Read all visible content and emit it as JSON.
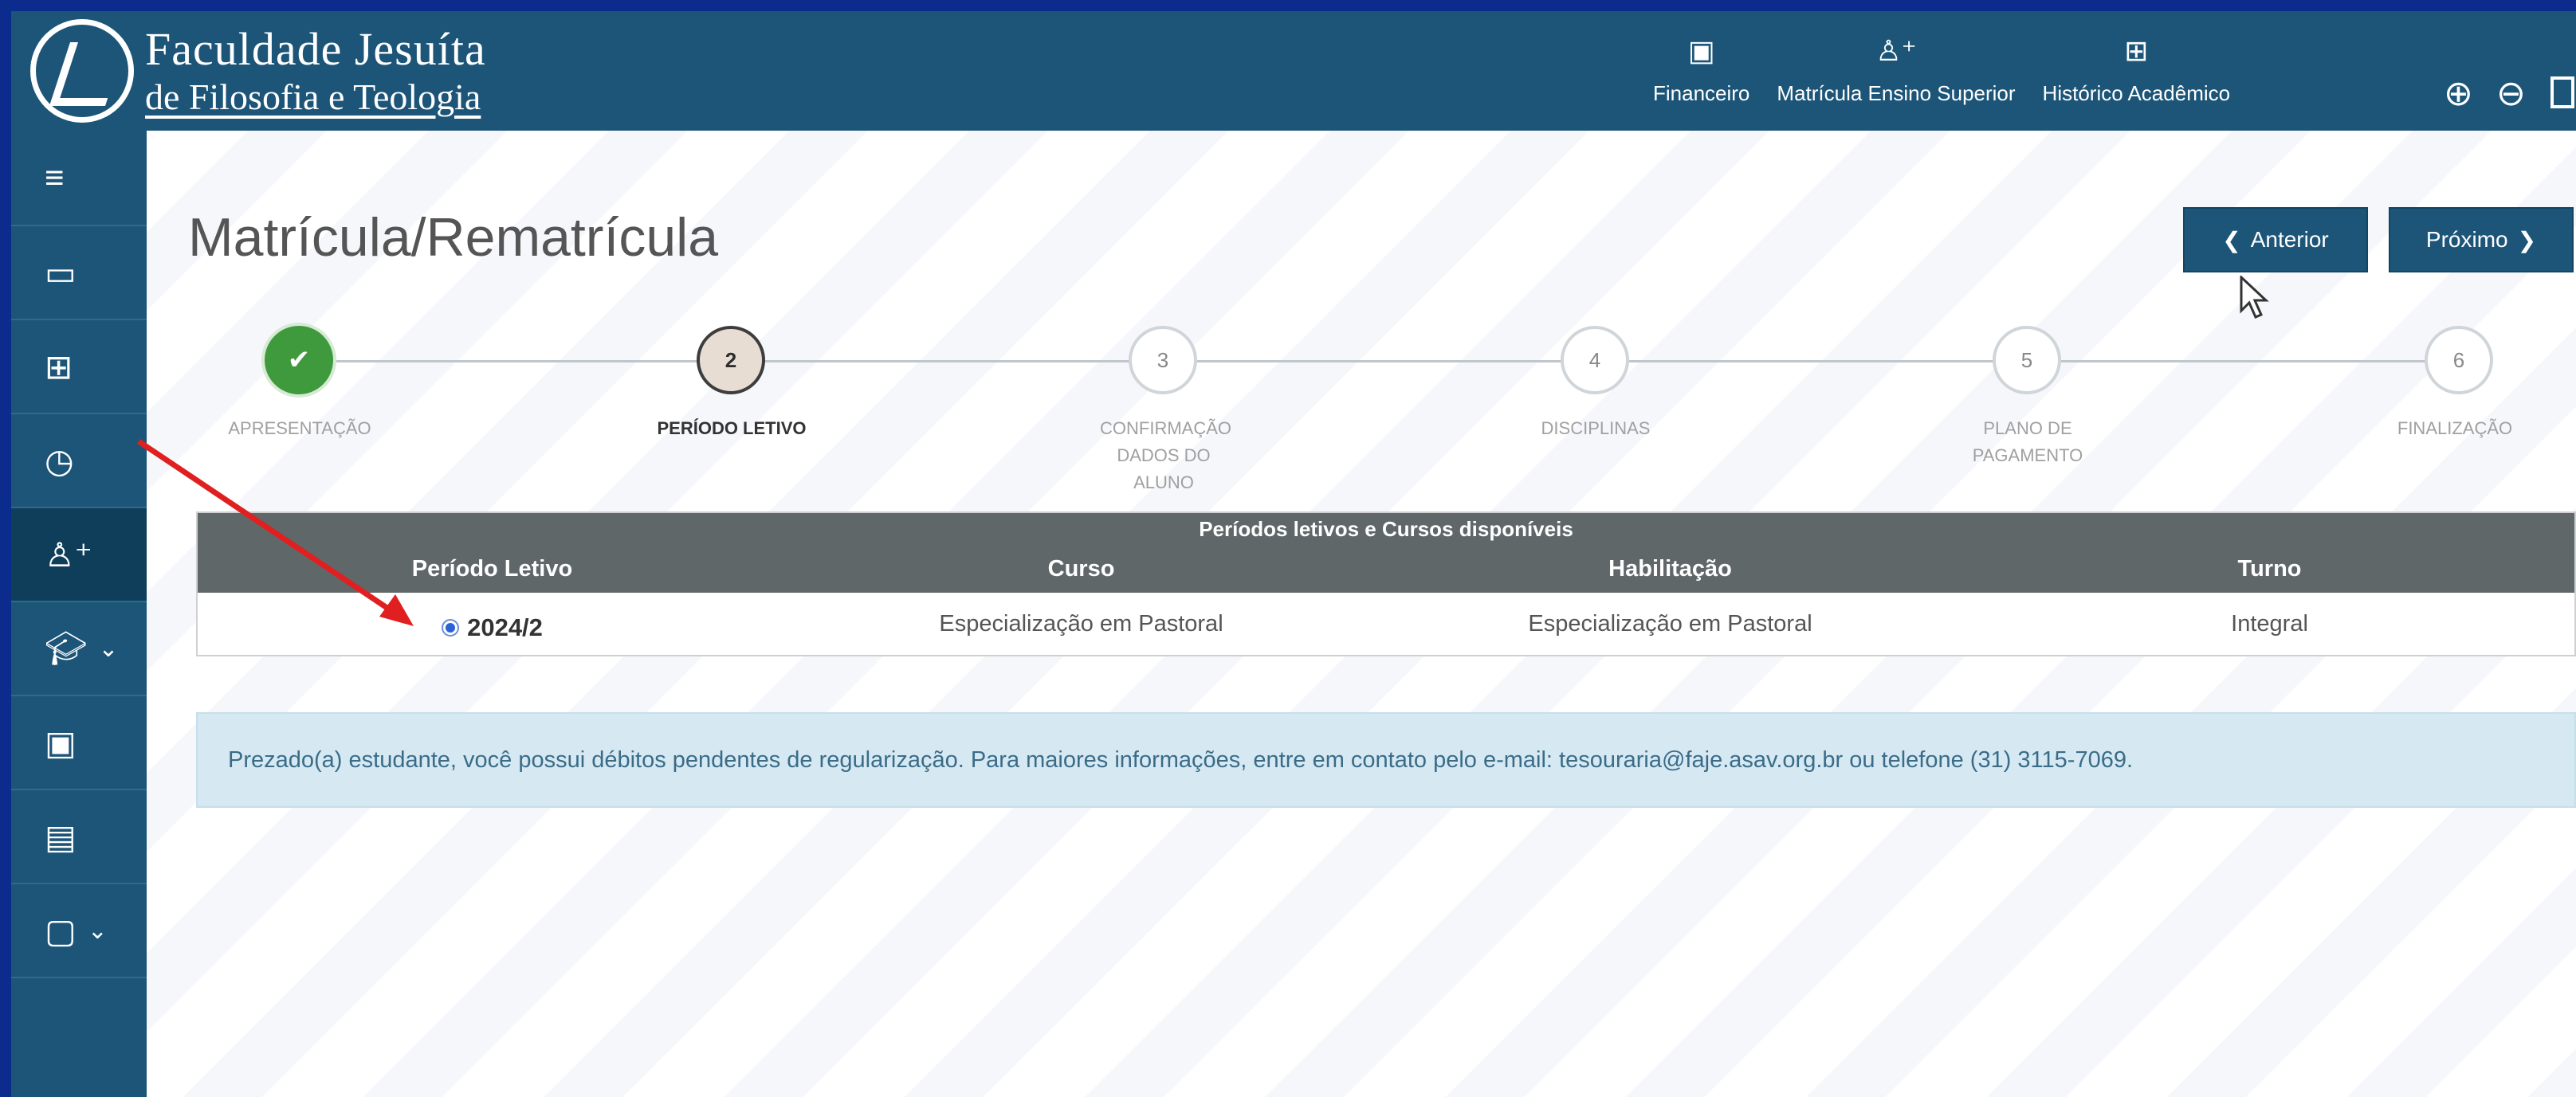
{
  "brand": {
    "line1": "Faculdade Jesuíta",
    "line2": "de Filosofia e Teologia"
  },
  "topnav": [
    {
      "label": "Financeiro",
      "icon": "dollar-doc-icon"
    },
    {
      "label": "Matrícula Ensino Superior",
      "icon": "add-user-icon"
    },
    {
      "label": "Histórico Acadêmico",
      "icon": "grid-icon"
    }
  ],
  "zoom": {
    "in_icon": "zoom-in-icon",
    "out_icon": "zoom-out-icon"
  },
  "sidebar": [
    {
      "icon": "menu-icon"
    },
    {
      "icon": "monitor-icon"
    },
    {
      "icon": "grid-icon"
    },
    {
      "icon": "clock-icon"
    },
    {
      "icon": "add-user-icon"
    },
    {
      "icon": "graduation-cap-icon"
    },
    {
      "icon": "dollar-doc-icon"
    },
    {
      "icon": "document-icon"
    },
    {
      "icon": "book-icon"
    }
  ],
  "page": {
    "title": "Matrícula/Rematrícula"
  },
  "buttons": {
    "prev": "Anterior",
    "next": "Próximo"
  },
  "steps": [
    {
      "number": "✔",
      "label": "APRESENTAÇÃO",
      "state": "done"
    },
    {
      "number": "2",
      "label": "PERÍODO LETIVO",
      "state": "current"
    },
    {
      "number": "3",
      "label": "CONFIRMAÇÃO DADOS DO ALUNO",
      "state": "pending"
    },
    {
      "number": "4",
      "label": "DISCIPLINAS",
      "state": "pending"
    },
    {
      "number": "5",
      "label": "PLANO DE PAGAMENTO",
      "state": "pending"
    },
    {
      "number": "6",
      "label": "FINALIZAÇÃO",
      "state": "pending"
    }
  ],
  "table": {
    "caption": "Períodos letivos e Cursos disponíveis",
    "headers": [
      "Período Letivo",
      "Curso",
      "Habilitação",
      "Turno"
    ],
    "rows": [
      {
        "periodo": "2024/2",
        "curso": "Especialização em Pastoral",
        "habilitacao": "Especialização em Pastoral",
        "turno": "Integral",
        "selected": true
      }
    ]
  },
  "alert": {
    "text": "Prezado(a) estudante, você possui débitos pendentes de regularização. Para maiores informações, entre em contato pelo e-mail: tesouraria@faje.asav.org.br ou telefone (31) 3115-7069."
  },
  "colors": {
    "primary": "#1c5578",
    "border_outer": "#0b2c8c",
    "annotation": "#e02020",
    "success": "#3f9a3d"
  }
}
